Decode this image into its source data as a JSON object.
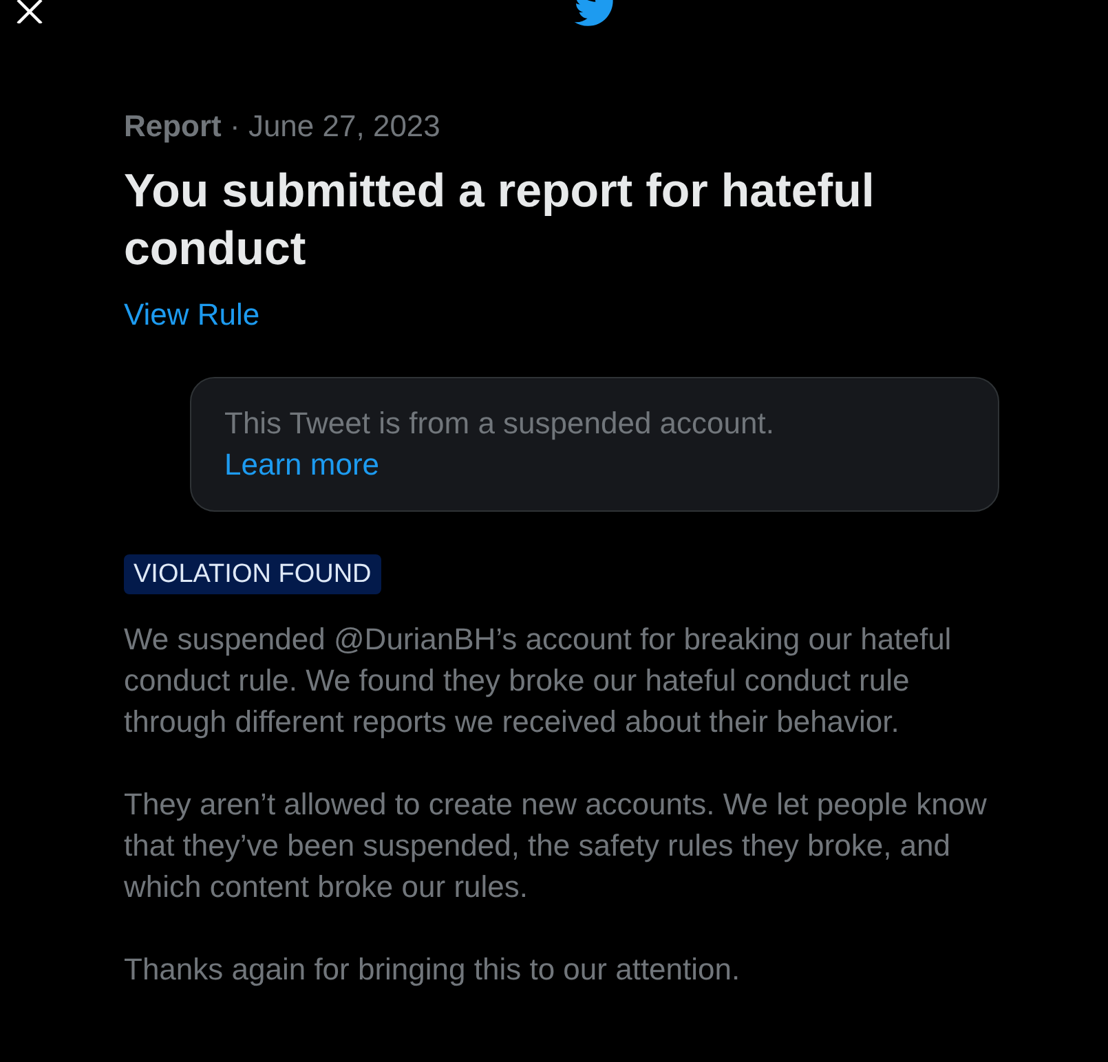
{
  "meta": "**Report** · June 27, 2023",
  "title": "You submitted a report for hateful conduct",
  "rule_link": "View Rule",
  "notice": {
    "text": "This Tweet is from a suspended account.",
    "link": "Learn more"
  },
  "status_tag": "VIOLATION FOUND",
  "paragraphs": [
    "We suspended @DurianBH’s account for breaking our hateful conduct rule. We found they broke our hateful conduct rule through different reports we received about their behavior.",
    "They aren’t allowed to create new accounts. We let people know that they’ve been suspended, the safety rules they broke, and which content broke our rules.",
    "Thanks again for bringing this to our attention."
  ]
}
